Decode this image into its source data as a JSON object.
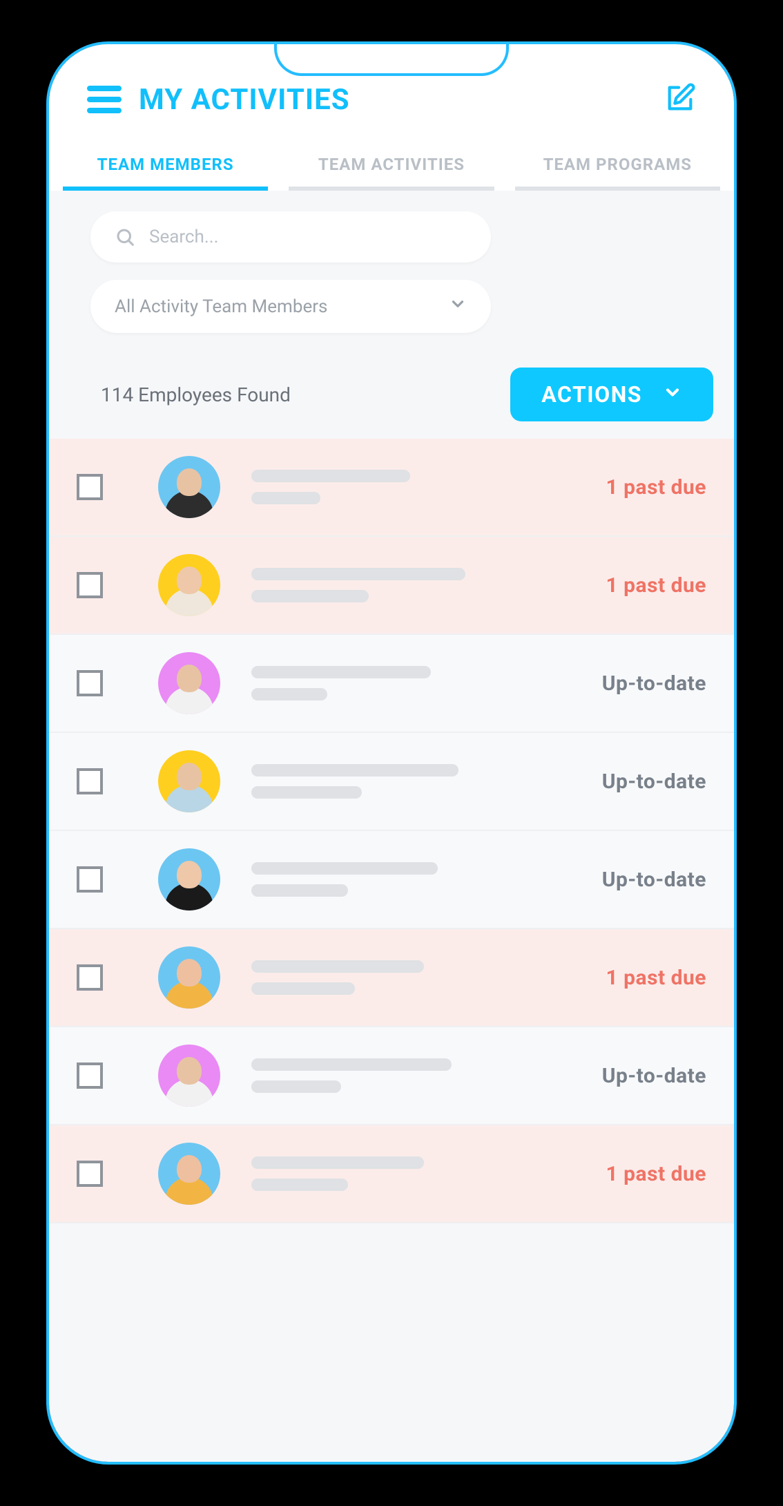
{
  "header": {
    "title": "MY ACTIVITIES"
  },
  "tabs": [
    {
      "label": "TEAM MEMBERS",
      "active": true
    },
    {
      "label": "TEAM ACTIVITIES",
      "active": false
    },
    {
      "label": "TEAM PROGRAMS",
      "active": false
    }
  ],
  "search": {
    "placeholder": "Search..."
  },
  "filter": {
    "selected": "All Activity Team Members"
  },
  "results_count_text": "114 Employees Found",
  "actions_button_label": "ACTIONS",
  "status_labels": {
    "past_due": "1 past due",
    "up_to_date": "Up-to-date"
  },
  "employees": [
    {
      "status": "past_due",
      "avatar_bg": "#6cc6f2",
      "skin": "#e8c3a3",
      "shirt": "#2d2d2d",
      "line1_w": 230,
      "line2_w": 100
    },
    {
      "status": "past_due",
      "avatar_bg": "#ffcf1f",
      "skin": "#eec8a8",
      "shirt": "#efe7db",
      "line1_w": 310,
      "line2_w": 170
    },
    {
      "status": "up_to_date",
      "avatar_bg": "#e98af5",
      "skin": "#e8c3a3",
      "shirt": "#f1f1f1",
      "line1_w": 260,
      "line2_w": 110
    },
    {
      "status": "up_to_date",
      "avatar_bg": "#ffcf1f",
      "skin": "#e8c3a3",
      "shirt": "#b9d6e6",
      "line1_w": 300,
      "line2_w": 160
    },
    {
      "status": "up_to_date",
      "avatar_bg": "#6cc6f2",
      "skin": "#eec8a8",
      "shirt": "#1a1a1a",
      "line1_w": 270,
      "line2_w": 140
    },
    {
      "status": "past_due",
      "avatar_bg": "#6cc6f2",
      "skin": "#eec0a0",
      "shirt": "#f2b544",
      "line1_w": 250,
      "line2_w": 150
    },
    {
      "status": "up_to_date",
      "avatar_bg": "#e98af5",
      "skin": "#e8c3a3",
      "shirt": "#f1f1f1",
      "line1_w": 290,
      "line2_w": 130
    },
    {
      "status": "past_due",
      "avatar_bg": "#6cc6f2",
      "skin": "#eec0a0",
      "shirt": "#f2b544",
      "line1_w": 250,
      "line2_w": 140
    }
  ]
}
